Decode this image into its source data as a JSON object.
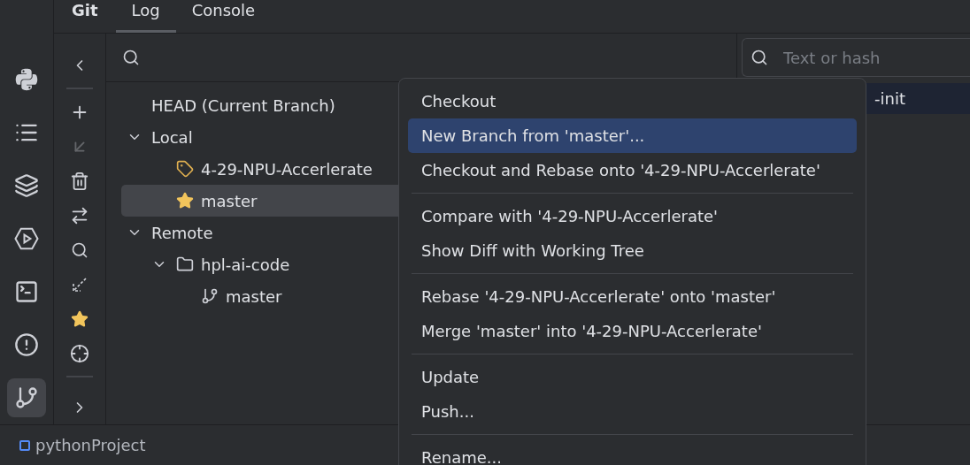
{
  "tool_strip": [
    {
      "selected": false
    },
    {
      "selected": false
    },
    {
      "selected": false
    },
    {
      "selected": false
    },
    {
      "selected": false
    },
    {
      "selected": false
    },
    {
      "selected": true
    }
  ],
  "tabs": [
    {
      "label": "Git",
      "kind": "title"
    },
    {
      "label": "Log",
      "kind": "tab",
      "selected": true
    },
    {
      "label": "Console",
      "kind": "tab",
      "selected": false
    }
  ],
  "toolbar": [
    {
      "kind": "collapse",
      "disabled": false
    },
    {
      "kind": "separator"
    },
    {
      "kind": "add",
      "disabled": false
    },
    {
      "kind": "update",
      "disabled": true
    },
    {
      "kind": "delete",
      "disabled": false
    },
    {
      "kind": "compare",
      "disabled": false
    },
    {
      "kind": "search",
      "disabled": false
    },
    {
      "kind": "fetch",
      "disabled": false
    },
    {
      "kind": "favorite",
      "disabled": false
    },
    {
      "kind": "locate",
      "disabled": false
    },
    {
      "kind": "separator"
    },
    {
      "kind": "expand",
      "disabled": false
    }
  ],
  "branches": [
    {
      "label": "HEAD (Current Branch)",
      "selected": false
    },
    {
      "label": "Local",
      "expanded": true,
      "selected": false,
      "children": [
        {
          "label": "4-29-NPU-Accerlerate",
          "kind": "tag",
          "selected": false
        },
        {
          "label": "master",
          "kind": "current",
          "selected": true
        }
      ]
    },
    {
      "label": "Remote",
      "expanded": true,
      "selected": false,
      "children": [
        {
          "label": "hpl-ai-code",
          "kind": "folder",
          "expanded": true,
          "selected": false,
          "children": [
            {
              "label": "master",
              "kind": "branch",
              "selected": false
            }
          ]
        }
      ]
    }
  ],
  "log": {
    "search": {
      "placeholder": "Text or hash"
    },
    "commits": [
      {
        "message": "-init",
        "selected": true
      }
    ]
  },
  "context_menu": {
    "groups": [
      [
        {
          "label": "Checkout",
          "selected": false
        },
        {
          "label": "New Branch from 'master'...",
          "selected": true
        },
        {
          "label": "Checkout and Rebase onto '4-29-NPU-Accerlerate'",
          "selected": false
        }
      ],
      [
        {
          "label": "Compare with '4-29-NPU-Accerlerate'",
          "selected": false
        },
        {
          "label": "Show Diff with Working Tree",
          "selected": false
        }
      ],
      [
        {
          "label": "Rebase '4-29-NPU-Accerlerate' onto 'master'",
          "selected": false
        },
        {
          "label": "Merge 'master' into '4-29-NPU-Accerlerate'",
          "selected": false
        }
      ],
      [
        {
          "label": "Update",
          "selected": false
        },
        {
          "label": "Push...",
          "selected": false
        }
      ],
      [
        {
          "label": "Rename...",
          "selected": false
        }
      ]
    ]
  },
  "status_bar": {
    "project": "pythonProject"
  }
}
